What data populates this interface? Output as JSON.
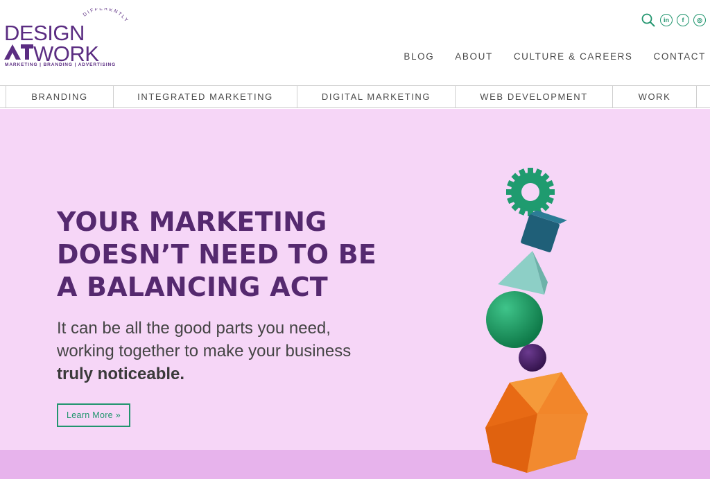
{
  "header": {
    "logo": {
      "line1": "DESIGN",
      "line2_at": "AT",
      "line2_work": "WORK",
      "arc_text": "DIFFERENTLY",
      "tagline": "MARKETING | BRANDING | ADVERTISING"
    },
    "social": {
      "linkedin": "in",
      "facebook": "f",
      "instagram": "◎"
    },
    "nav": [
      {
        "label": "BLOG"
      },
      {
        "label": "ABOUT"
      },
      {
        "label": "CULTURE & CAREERS"
      },
      {
        "label": "CONTACT"
      }
    ]
  },
  "services": [
    {
      "label": "BRANDING"
    },
    {
      "label": "INTEGRATED MARKETING"
    },
    {
      "label": "DIGITAL MARKETING"
    },
    {
      "label": "WEB DEVELOPMENT"
    },
    {
      "label": "WORK"
    }
  ],
  "hero": {
    "headline_lines": [
      "YOUR MARKETING",
      "DOESN’T NEED TO BE",
      "A BALANCING ACT"
    ],
    "sub_line1": "It can be all the good parts you need,",
    "sub_line2": "working together to make your business",
    "sub_strong": "truly noticeable.",
    "cta_label": "Learn More »"
  },
  "colors": {
    "brand_purple": "#5b2d82",
    "accent_green": "#21956e",
    "hero_bg": "#f6d6f7",
    "floor": "#e7b3ec",
    "gear": "#1f9b6f",
    "cube": "#1f5f78",
    "pyramid": "#8dcfc6",
    "sphere_green": "#17985e",
    "sphere_purple": "#4b1f6b",
    "icosahedron": "#f07a1f"
  },
  "icons": [
    "search-icon",
    "linkedin-icon",
    "facebook-icon",
    "instagram-icon",
    "double-chevron-right-icon"
  ]
}
